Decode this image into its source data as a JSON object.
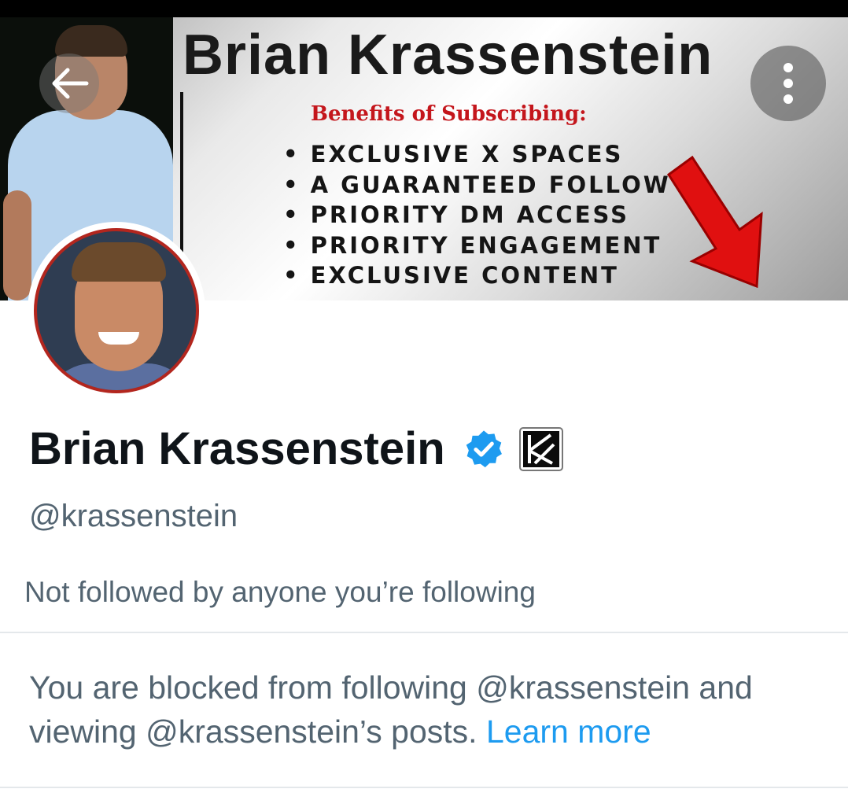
{
  "banner": {
    "title": "Brian Krassenstein",
    "subtitle": "Benefits of Subscribing:",
    "benefits": [
      "EXCLUSIVE X SPACES",
      "A GUARANTEED FOLLOW",
      "PRIORITY DM ACCESS",
      "PRIORITY ENGAGEMENT",
      "EXCLUSIVE CONTENT"
    ]
  },
  "nav": {
    "back_icon": "arrow-left-icon",
    "more_icon": "vertical-ellipsis-icon"
  },
  "profile": {
    "name": "Brian Krassenstein",
    "verified_badge": "verified-badge-icon",
    "verified_color": "#1d9bf0",
    "affiliate_badge": "affiliate-logo-icon",
    "handle": "@krassenstein",
    "followers_note": "Not followed by anyone you’re following"
  },
  "blocked_notice": {
    "text": "You are blocked from following @krassenstein and viewing @krassenstein’s posts.",
    "link_label": "Learn more",
    "link_color": "#1d9bf0"
  }
}
